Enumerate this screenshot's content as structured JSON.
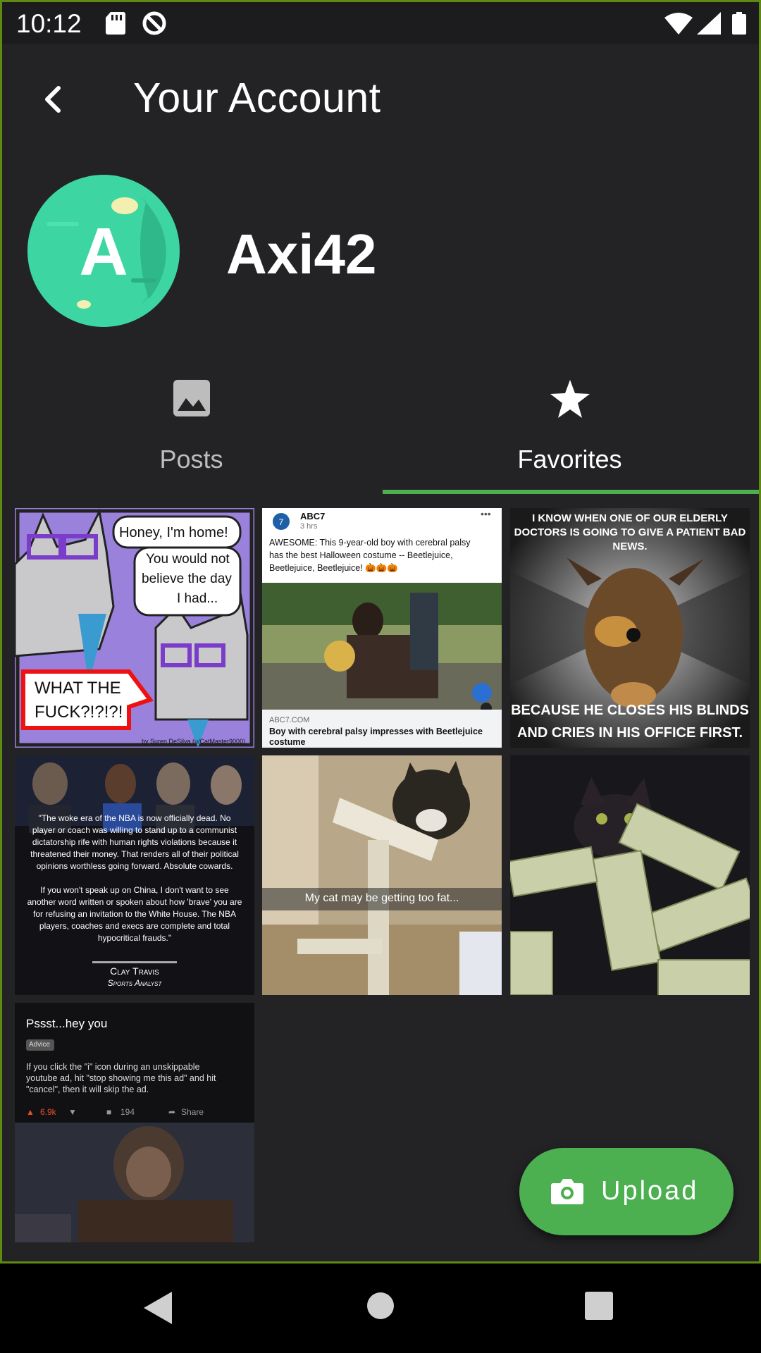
{
  "status_bar": {
    "time": "10:12"
  },
  "app_bar": {
    "title": "Your Account"
  },
  "profile": {
    "avatar_letter": "A",
    "username": "Axi42"
  },
  "tabs": [
    {
      "label": "Posts",
      "icon": "image-icon",
      "selected": false
    },
    {
      "label": "Favorites",
      "icon": "star-icon",
      "selected": true
    }
  ],
  "favorites": [
    {
      "speech_1": "Honey, I'm home!",
      "speech_2": [
        "You would not",
        "believe the day",
        "I had..."
      ],
      "speech_3": [
        "WHAT THE",
        "FUCK?!?!?!"
      ],
      "credit": "by Suren DeSilva (u/CatMaster9000)"
    },
    {
      "source": "ABC7",
      "time": "3 hrs",
      "post_text": [
        "AWESOME: This 9-year-old boy with cerebral palsy",
        "has the best Halloween costume -- Beetlejuice,",
        "Beetlejuice, Beetlejuice! 🎃🎃🎃"
      ],
      "link_domain": "ABC7.COM",
      "link_title": [
        "Boy with cerebral palsy impresses with Beetlejuice",
        "costume"
      ]
    },
    {
      "top_text": [
        "I KNOW WHEN ONE OF OUR ELDERLY",
        "DOCTORS IS GOING TO GIVE A PATIENT BAD",
        "NEWS."
      ],
      "bottom_text": [
        "BECAUSE HE CLOSES HIS BLINDS",
        "AND CRIES IN HIS OFFICE FIRST."
      ]
    },
    {
      "quote": [
        "\"The woke era of the NBA is now officially dead. No",
        "player or coach was willing to stand up to a communist",
        "dictatorship rife with human rights violations because it",
        "threatened their money. That renders all of their political",
        "opinions worthless going forward. Absolute cowards.",
        "",
        "If you won't speak up on China, I don't want to see",
        "another word written or spoken about how 'brave' you are",
        "for refusing an invitation to the White House. The NBA",
        "players, coaches and execs are complete and total",
        "hypocritical frauds.\""
      ],
      "author": "Clay Travis",
      "author_title": "Sports Analyst"
    },
    {
      "caption": "My cat may be getting too fat..."
    },
    {},
    {
      "title": "Pssst...hey you",
      "flair": "Advice",
      "body": [
        "If you click the \"i\" icon during an unskippable",
        "youtube ad, hit \"stop showing me this ad\" and hit",
        "\"cancel\", then it will skip the ad."
      ],
      "upvotes": "6.9k",
      "comments": "194",
      "share": "Share"
    }
  ],
  "fab": {
    "label": "Upload",
    "icon": "camera-icon"
  },
  "colors": {
    "accent": "#4caf50",
    "background": "#232326",
    "avatar": "#3dd6a3"
  }
}
